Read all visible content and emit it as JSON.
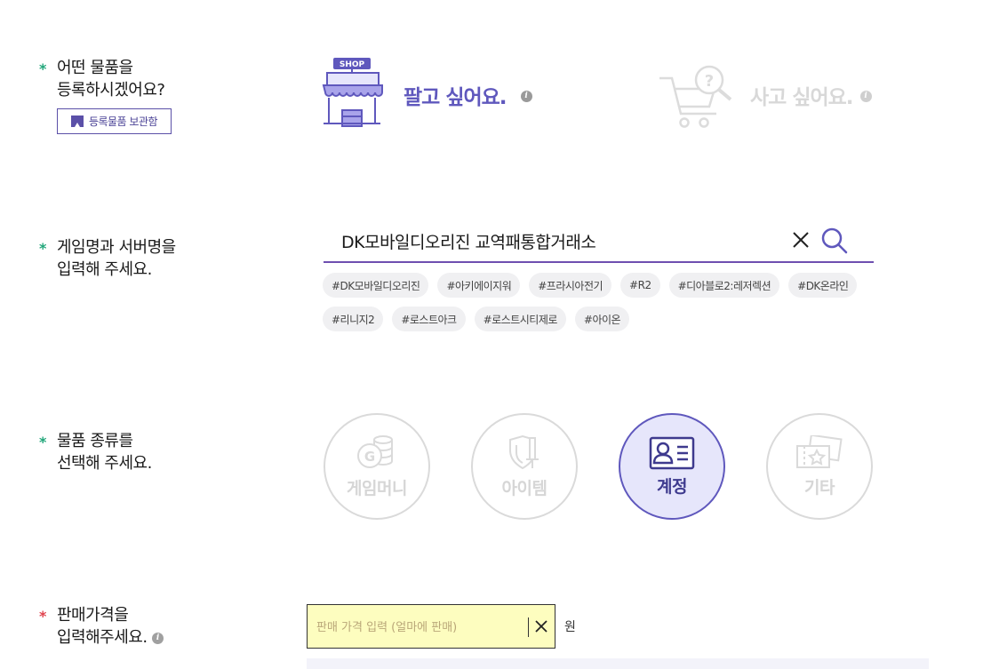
{
  "section_register": {
    "label": "어떤 물품을\n등록하시겠어요?",
    "saved_button": "등록물품 보관함"
  },
  "trade": {
    "sell_label": "팔고 싶어요.",
    "buy_label": "사고 싶어요.",
    "shop_sign": "SHOP",
    "selected": "sell"
  },
  "section_game": {
    "label": "게임명과 서버명을\n입력해 주세요.",
    "search_value": "DK모바일디오리진 교역패통합거래소",
    "tags": [
      "#DK모바일디오리진",
      "#아키에이지워",
      "#프라시아전기",
      "#R2",
      "#디아블로2:레저렉션",
      "#DK온라인",
      "#리니지2",
      "#로스트아크",
      "#로스트시티제로",
      "#아이온"
    ]
  },
  "section_category": {
    "label": "물품 종류를\n선택해 주세요.",
    "items": [
      {
        "label": "게임머니",
        "icon": "coin-icon"
      },
      {
        "label": "아이템",
        "icon": "shield-sword-icon"
      },
      {
        "label": "계정",
        "icon": "id-card-icon"
      },
      {
        "label": "기타",
        "icon": "ticket-icon"
      }
    ],
    "selected_index": 2
  },
  "section_price": {
    "label": "판매가격을\n입력해주세요.",
    "placeholder": "판매 가격 입력 (얼마에 판매)",
    "value": "",
    "unit": "원"
  },
  "colors": {
    "accent": "#5f58bd",
    "required_green": "#21a67a",
    "required_red": "#e0434e",
    "price_bg": "#fdfdbf"
  }
}
